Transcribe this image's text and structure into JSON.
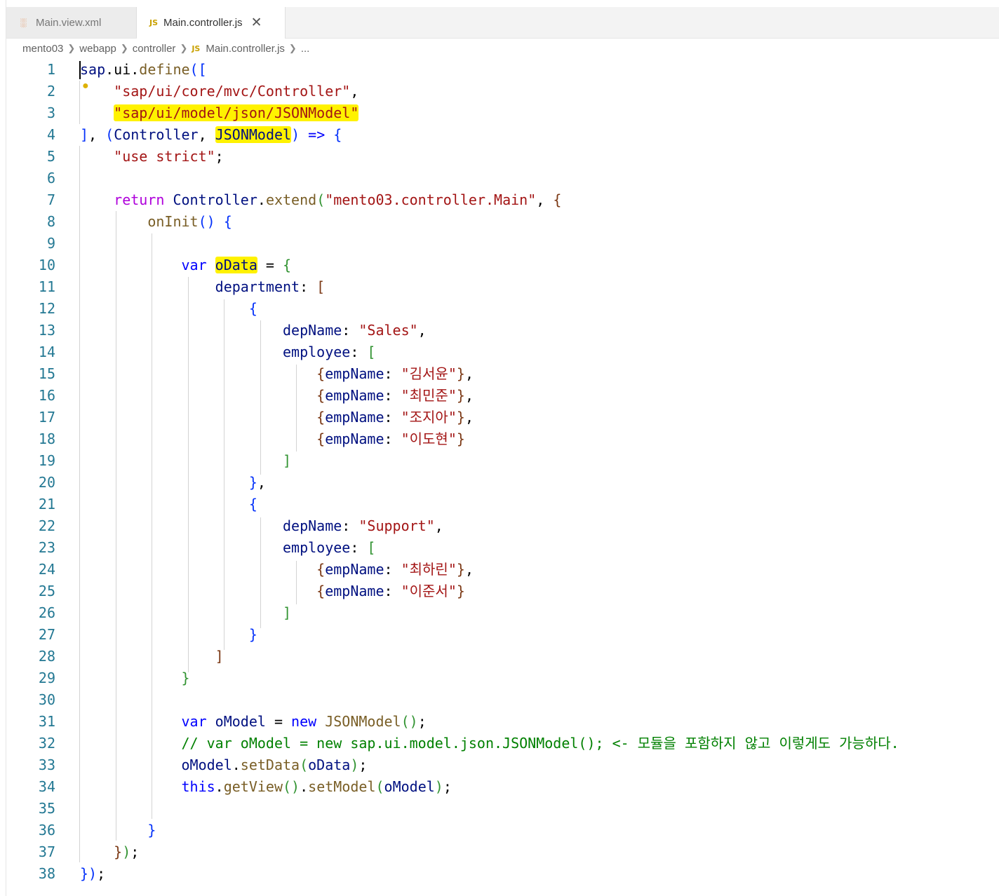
{
  "tabs": [
    {
      "label": "Main.view.xml",
      "icon": "xml-file-icon",
      "active": false
    },
    {
      "label": "Main.controller.js",
      "icon": "js-file-icon",
      "active": true
    }
  ],
  "breadcrumb": [
    "mento03",
    "webapp",
    "controller",
    "Main.controller.js",
    "..."
  ],
  "code": {
    "l1a": "sap",
    "l1b": ".ui.",
    "l1c": "define",
    "l1d": "([",
    "l2": "\"sap/ui/core/mvc/Controller\"",
    "l3": "\"sap/ui/model/json/JSONModel\"",
    "l4a": "], ",
    "l4b": "(",
    "l4c": "Controller",
    "l4d": ", ",
    "l4e": "JSONModel",
    "l4f": ")",
    "l4g": " => ",
    "l4h": "{",
    "l5": "\"use strict\"",
    "l7a": "return",
    "l7b": "Controller",
    "l7c": "extend",
    "l7d": "(",
    "l7e": "\"mento03.controller.Main\"",
    "l7f": "{",
    "l8a": "onInit",
    "l8b": "()",
    "l8c": "{",
    "l10a": "var",
    "l10b": "oData",
    "l10c": " = ",
    "l10d": "{",
    "l11a": "department",
    "l11b": "[",
    "l13a": "depName",
    "l13b": "\"Sales\"",
    "l14a": "employee",
    "l14b": "[",
    "emp_key": "empName",
    "e15": "\"김서윤\"",
    "e16": "\"최민준\"",
    "e17": "\"조지아\"",
    "e18": "\"이도현\"",
    "l22b": "\"Support\"",
    "e24": "\"최하린\"",
    "e25": "\"이준서\"",
    "l31a": "var",
    "l31b": "oModel",
    "l31c": "new",
    "l31d": "JSONModel",
    "l32": "// var oModel = new sap.ui.model.json.JSONModel(); <- 모듈을 포함하지 않고 이렇게도 가능하다.",
    "l33a": "oModel",
    "l33b": "setData",
    "l33c": "oData",
    "l34a": "this",
    "l34b": "getView",
    "l34c": "setModel",
    "l34d": "oModel"
  },
  "line_numbers": [
    "1",
    "2",
    "3",
    "4",
    "5",
    "6",
    "7",
    "8",
    "9",
    "10",
    "11",
    "12",
    "13",
    "14",
    "15",
    "16",
    "17",
    "18",
    "19",
    "20",
    "21",
    "22",
    "23",
    "24",
    "25",
    "26",
    "27",
    "28",
    "29",
    "30",
    "31",
    "32",
    "33",
    "34",
    "35",
    "36",
    "37",
    "38"
  ],
  "colors": {
    "keyword": "#0000ff",
    "control": "#af00db",
    "string": "#a31515",
    "variable": "#001080",
    "function": "#795e26",
    "comment": "#008000",
    "line_number": "#237893",
    "highlight": "#fff200"
  }
}
